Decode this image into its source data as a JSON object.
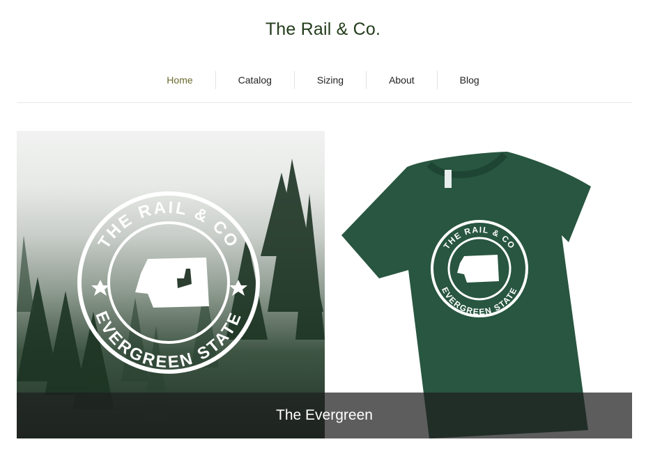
{
  "header": {
    "title": "The Rail & Co."
  },
  "nav": {
    "items": [
      {
        "label": "Home",
        "active": true
      },
      {
        "label": "Catalog"
      },
      {
        "label": "Sizing"
      },
      {
        "label": "About"
      },
      {
        "label": "Blog"
      }
    ]
  },
  "product": {
    "name": "The Evergreen",
    "shirt_color": "#285640",
    "badge": {
      "top_text": "THE RAIL & CO",
      "bottom_text": "EVERGREEN STATE"
    }
  },
  "colors": {
    "title": "#233d1c",
    "active_nav": "#6a6a2e"
  }
}
